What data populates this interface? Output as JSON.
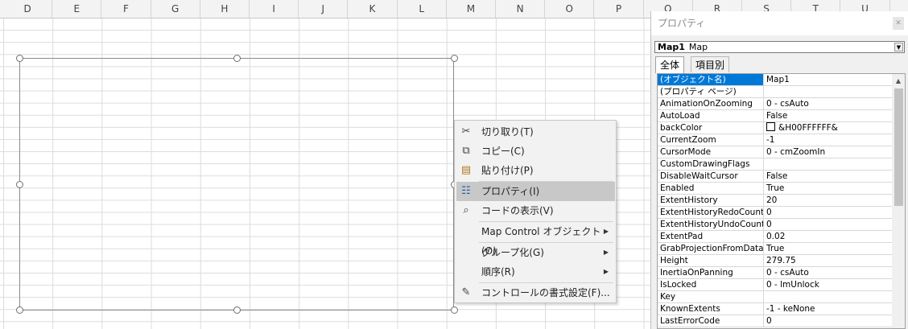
{
  "sheet": {
    "columns": [
      "D",
      "E",
      "F",
      "G",
      "H",
      "I",
      "J",
      "K",
      "L",
      "M",
      "N",
      "O",
      "P",
      "Q",
      "R",
      "S",
      "T",
      "U"
    ]
  },
  "context_menu": {
    "items": [
      {
        "label": "切り取り(T)",
        "icon": "scissors-icon"
      },
      {
        "label": "コピー(C)",
        "icon": "copy-icon"
      },
      {
        "label": "貼り付け(P)",
        "icon": "paste-icon"
      },
      {
        "label": "プロパティ(I)",
        "icon": "properties-icon",
        "highlighted": true
      },
      {
        "label": "コードの表示(V)",
        "icon": "view-code-icon"
      },
      {
        "label": "Map Control オブジェクト(O)",
        "submenu": true
      },
      {
        "label": "グループ化(G)",
        "submenu": true
      },
      {
        "label": "順序(R)",
        "submenu": true
      },
      {
        "label": "コントロールの書式設定(F)...",
        "icon": "format-control-icon"
      }
    ]
  },
  "properties": {
    "title": "プロパティ",
    "object_name": "Map1",
    "object_type": "Map",
    "tabs": [
      "全体",
      "項目別"
    ],
    "rows": [
      {
        "name": "(オブジェクト名)",
        "value": "Map1"
      },
      {
        "name": "(プロパティ ページ)",
        "value": ""
      },
      {
        "name": "AnimationOnZooming",
        "value": "0 - csAuto"
      },
      {
        "name": "AutoLoad",
        "value": "False"
      },
      {
        "name": "backColor",
        "value": "&H00FFFFFF&"
      },
      {
        "name": "CurrentZoom",
        "value": "-1"
      },
      {
        "name": "CursorMode",
        "value": "0 - cmZoomIn"
      },
      {
        "name": "CustomDrawingFlags",
        "value": ""
      },
      {
        "name": "DisableWaitCursor",
        "value": "False"
      },
      {
        "name": "Enabled",
        "value": "True"
      },
      {
        "name": "ExtentHistory",
        "value": "20"
      },
      {
        "name": "ExtentHistoryRedoCount",
        "value": "0"
      },
      {
        "name": "ExtentHistoryUndoCount",
        "value": "0"
      },
      {
        "name": "ExtentPad",
        "value": "0.02"
      },
      {
        "name": "GrabProjectionFromData",
        "value": "True"
      },
      {
        "name": "Height",
        "value": "279.75"
      },
      {
        "name": "InertiaOnPanning",
        "value": "0 - csAuto"
      },
      {
        "name": "IsLocked",
        "value": "0 - lmUnlock"
      },
      {
        "name": "Key",
        "value": ""
      },
      {
        "name": "KnownExtents",
        "value": "-1 - keNone"
      },
      {
        "name": "LastErrorCode",
        "value": "0"
      }
    ],
    "colors": {
      "selection": "#0078d7",
      "swatch": "#FFFFFF"
    }
  }
}
